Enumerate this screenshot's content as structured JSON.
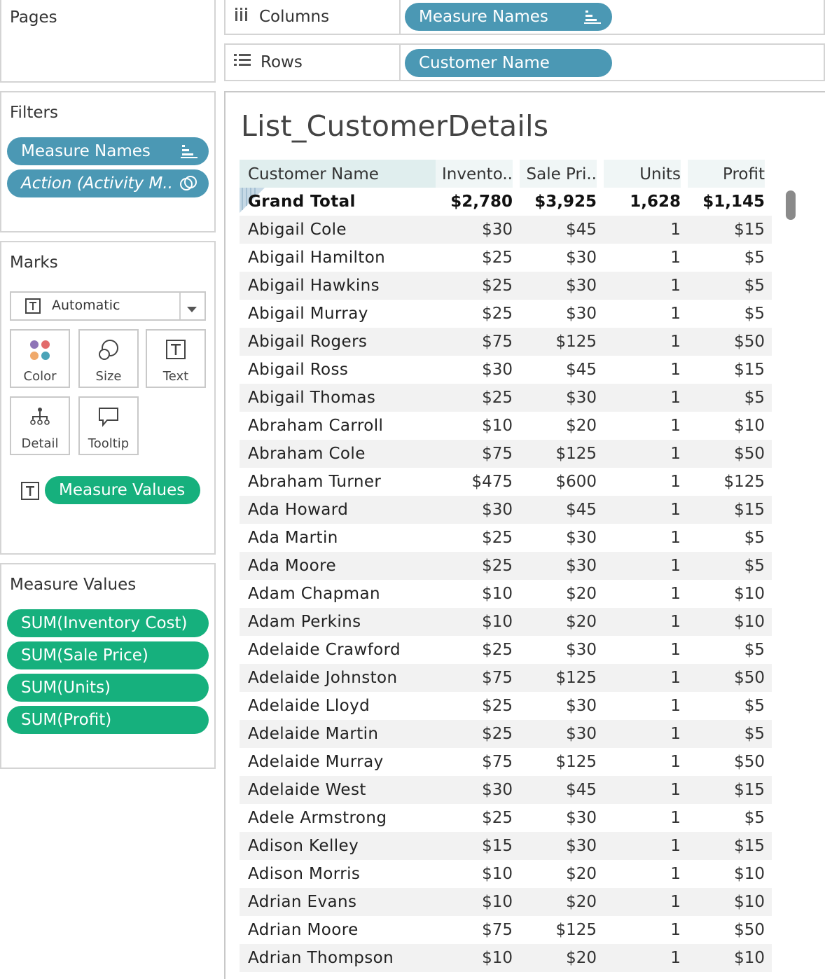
{
  "pages": {
    "title": "Pages"
  },
  "shelves": {
    "columns": {
      "label": "Columns",
      "pill": "Measure Names"
    },
    "rows": {
      "label": "Rows",
      "pill": "Customer Name"
    }
  },
  "filters": {
    "title": "Filters",
    "items": [
      {
        "label": "Measure Names"
      },
      {
        "label": "Action (Activity M.."
      }
    ]
  },
  "marks": {
    "title": "Marks",
    "type_label": "Automatic",
    "buttons": {
      "color": "Color",
      "size": "Size",
      "text": "Text",
      "detail": "Detail",
      "tooltip": "Tooltip"
    },
    "text_pill": "Measure Values"
  },
  "measure_values": {
    "title": "Measure Values",
    "items": [
      "SUM(Inventory Cost)",
      "SUM(Sale Price)",
      "SUM(Units)",
      "SUM(Profit)"
    ]
  },
  "view": {
    "title": "List_CustomerDetails",
    "headers": {
      "name": "Customer Name",
      "inventory": "Invento..",
      "sale": "Sale Pri..",
      "units": "Units",
      "profit": "Profit"
    },
    "grand_total": {
      "name": "Grand Total",
      "inventory": "$2,780",
      "sale": "$3,925",
      "units": "1,628",
      "profit": "$1,145"
    },
    "rows": [
      {
        "name": "Abigail Cole",
        "inventory": "$30",
        "sale": "$45",
        "units": "1",
        "profit": "$15"
      },
      {
        "name": "Abigail Hamilton",
        "inventory": "$25",
        "sale": "$30",
        "units": "1",
        "profit": "$5"
      },
      {
        "name": "Abigail Hawkins",
        "inventory": "$25",
        "sale": "$30",
        "units": "1",
        "profit": "$5"
      },
      {
        "name": "Abigail Murray",
        "inventory": "$25",
        "sale": "$30",
        "units": "1",
        "profit": "$5"
      },
      {
        "name": "Abigail Rogers",
        "inventory": "$75",
        "sale": "$125",
        "units": "1",
        "profit": "$50"
      },
      {
        "name": "Abigail Ross",
        "inventory": "$30",
        "sale": "$45",
        "units": "1",
        "profit": "$15"
      },
      {
        "name": "Abigail Thomas",
        "inventory": "$25",
        "sale": "$30",
        "units": "1",
        "profit": "$5"
      },
      {
        "name": "Abraham Carroll",
        "inventory": "$10",
        "sale": "$20",
        "units": "1",
        "profit": "$10"
      },
      {
        "name": "Abraham Cole",
        "inventory": "$75",
        "sale": "$125",
        "units": "1",
        "profit": "$50"
      },
      {
        "name": "Abraham Turner",
        "inventory": "$475",
        "sale": "$600",
        "units": "1",
        "profit": "$125"
      },
      {
        "name": "Ada Howard",
        "inventory": "$30",
        "sale": "$45",
        "units": "1",
        "profit": "$15"
      },
      {
        "name": "Ada Martin",
        "inventory": "$25",
        "sale": "$30",
        "units": "1",
        "profit": "$5"
      },
      {
        "name": "Ada Moore",
        "inventory": "$25",
        "sale": "$30",
        "units": "1",
        "profit": "$5"
      },
      {
        "name": "Adam Chapman",
        "inventory": "$10",
        "sale": "$20",
        "units": "1",
        "profit": "$10"
      },
      {
        "name": "Adam Perkins",
        "inventory": "$10",
        "sale": "$20",
        "units": "1",
        "profit": "$10"
      },
      {
        "name": "Adelaide Crawford",
        "inventory": "$25",
        "sale": "$30",
        "units": "1",
        "profit": "$5"
      },
      {
        "name": "Adelaide Johnston",
        "inventory": "$75",
        "sale": "$125",
        "units": "1",
        "profit": "$50"
      },
      {
        "name": "Adelaide Lloyd",
        "inventory": "$25",
        "sale": "$30",
        "units": "1",
        "profit": "$5"
      },
      {
        "name": "Adelaide Martin",
        "inventory": "$25",
        "sale": "$30",
        "units": "1",
        "profit": "$5"
      },
      {
        "name": "Adelaide Murray",
        "inventory": "$75",
        "sale": "$125",
        "units": "1",
        "profit": "$50"
      },
      {
        "name": "Adelaide West",
        "inventory": "$30",
        "sale": "$45",
        "units": "1",
        "profit": "$15"
      },
      {
        "name": "Adele Armstrong",
        "inventory": "$25",
        "sale": "$30",
        "units": "1",
        "profit": "$5"
      },
      {
        "name": "Adison Kelley",
        "inventory": "$15",
        "sale": "$30",
        "units": "1",
        "profit": "$15"
      },
      {
        "name": "Adison Morris",
        "inventory": "$10",
        "sale": "$20",
        "units": "1",
        "profit": "$10"
      },
      {
        "name": "Adrian Evans",
        "inventory": "$10",
        "sale": "$20",
        "units": "1",
        "profit": "$10"
      },
      {
        "name": "Adrian Moore",
        "inventory": "$75",
        "sale": "$125",
        "units": "1",
        "profit": "$50"
      },
      {
        "name": "Adrian Thompson",
        "inventory": "$10",
        "sale": "$20",
        "units": "1",
        "profit": "$10"
      }
    ]
  },
  "colors": {
    "pill_blue": "#4b98b4",
    "pill_green": "#16b07d",
    "header_bg": "#e0eeee"
  }
}
